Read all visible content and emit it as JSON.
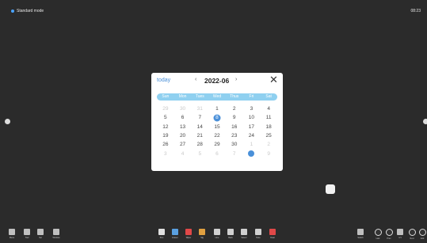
{
  "topbar": {
    "mode_label": "Standard mode",
    "clock": "08:23"
  },
  "calendar": {
    "today_label": "today",
    "month_label": "2022-06",
    "prev_glyph": "‹",
    "next_glyph": "›",
    "close_glyph": "✕",
    "weekdays": [
      "Sun",
      "Mon",
      "Tues",
      "Wed",
      "Thus",
      "Fri",
      "Sat"
    ],
    "days": [
      {
        "d": "29",
        "o": true
      },
      {
        "d": "30",
        "o": true
      },
      {
        "d": "31",
        "o": true
      },
      {
        "d": "1"
      },
      {
        "d": "2"
      },
      {
        "d": "3"
      },
      {
        "d": "4"
      },
      {
        "d": "5"
      },
      {
        "d": "6"
      },
      {
        "d": "7"
      },
      {
        "d": "8",
        "s": true
      },
      {
        "d": "9"
      },
      {
        "d": "10"
      },
      {
        "d": "11"
      },
      {
        "d": "12"
      },
      {
        "d": "13"
      },
      {
        "d": "14"
      },
      {
        "d": "15"
      },
      {
        "d": "16"
      },
      {
        "d": "17"
      },
      {
        "d": "18"
      },
      {
        "d": "19"
      },
      {
        "d": "20"
      },
      {
        "d": "21"
      },
      {
        "d": "22"
      },
      {
        "d": "23"
      },
      {
        "d": "24"
      },
      {
        "d": "25"
      },
      {
        "d": "26"
      },
      {
        "d": "27"
      },
      {
        "d": "28"
      },
      {
        "d": "29"
      },
      {
        "d": "30"
      },
      {
        "d": "1",
        "o": true
      },
      {
        "d": "2",
        "o": true
      },
      {
        "d": "3",
        "o": true
      },
      {
        "d": "4",
        "o": true
      },
      {
        "d": "5",
        "o": true
      },
      {
        "d": "6",
        "o": true
      },
      {
        "d": "7",
        "o": true
      },
      {
        "d": "",
        "m": true
      },
      {
        "d": "9",
        "o": true
      }
    ],
    "selected_color": "#4a90d9",
    "weekbar_color": "#8fd0f0"
  },
  "bottom_left": [
    {
      "label": "Menu",
      "icon": "menu-icon"
    },
    {
      "label": "Tool",
      "icon": "tool-icon"
    },
    {
      "label": "Set",
      "icon": "settings-icon"
    },
    {
      "label": "Window",
      "icon": "window-icon"
    }
  ],
  "bottom_center": [
    {
      "label": "Pen",
      "icon": "pen-icon",
      "color": "#e0e0e0"
    },
    {
      "label": "Eraser",
      "icon": "eraser-icon",
      "color": "#5aa0e0"
    },
    {
      "label": "Wiper",
      "icon": "wiper-icon",
      "color": "#e04848"
    },
    {
      "label": "Sig",
      "icon": "signature-icon",
      "color": "#e0a040"
    },
    {
      "label": "Line",
      "icon": "line-icon",
      "color": "#d0d0d0"
    },
    {
      "label": "Back",
      "icon": "back-icon",
      "color": "#d0d0d0"
    },
    {
      "label": "Select",
      "icon": "select-icon",
      "color": "#d0d0d0"
    },
    {
      "label": "Note",
      "icon": "note-icon",
      "color": "#d0d0d0"
    },
    {
      "label": "Clear",
      "icon": "clear-icon",
      "color": "#e04848"
    }
  ],
  "bottom_right": [
    {
      "label": "Switch",
      "icon": "switch-icon"
    },
    {
      "label": "Last",
      "icon": "last-icon"
    },
    {
      "label": "Prev",
      "icon": "prev-icon"
    },
    {
      "label": "1/1",
      "icon": "page-icon"
    },
    {
      "label": "Next",
      "icon": "next-icon"
    },
    {
      "label": "Add",
      "icon": "add-icon"
    }
  ]
}
